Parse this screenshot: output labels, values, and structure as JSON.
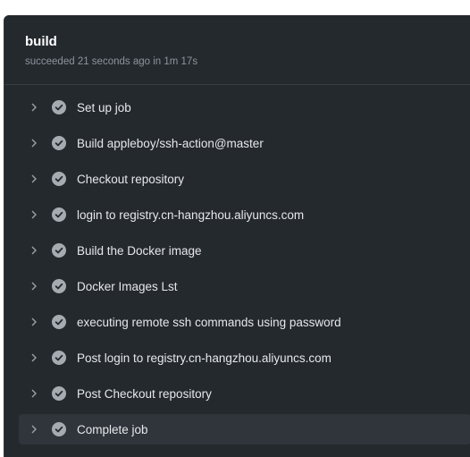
{
  "job": {
    "name": "build",
    "status": "succeeded 21 seconds ago in 1m 17s"
  },
  "steps": [
    {
      "label": "Set up job",
      "icon": "check-circle-icon",
      "state": "success"
    },
    {
      "label": "Build appleboy/ssh-action@master",
      "icon": "check-circle-icon",
      "state": "success"
    },
    {
      "label": "Checkout repository",
      "icon": "check-circle-icon",
      "state": "success"
    },
    {
      "label": "login to registry.cn-hangzhou.aliyuncs.com",
      "icon": "check-circle-icon",
      "state": "success"
    },
    {
      "label": "Build the Docker image",
      "icon": "check-circle-icon",
      "state": "success"
    },
    {
      "label": "Docker Images Lst",
      "icon": "check-circle-icon",
      "state": "success"
    },
    {
      "label": "executing remote ssh commands using password",
      "icon": "check-circle-icon",
      "state": "success"
    },
    {
      "label": "Post login to registry.cn-hangzhou.aliyuncs.com",
      "icon": "check-circle-icon",
      "state": "success"
    },
    {
      "label": "Post Checkout repository",
      "icon": "check-circle-icon",
      "state": "success"
    },
    {
      "label": "Complete job",
      "icon": "check-circle-icon",
      "state": "success"
    }
  ],
  "colors": {
    "panel_bg": "#24292e",
    "text": "#e6e8ea",
    "muted": "#8c949c",
    "check": "#a5abb1"
  }
}
